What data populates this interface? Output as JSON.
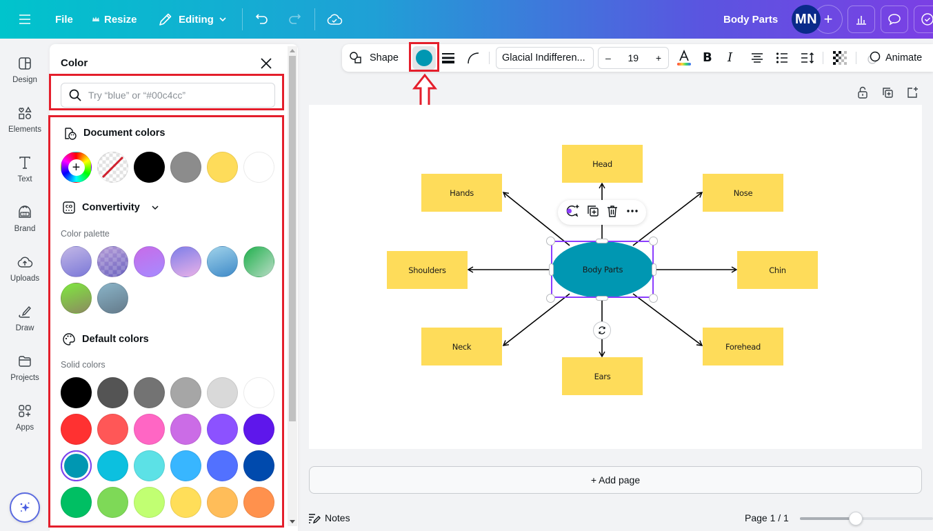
{
  "topbar": {
    "file_label": "File",
    "resize_label": "Resize",
    "editing_label": "Editing",
    "document_title": "Body Parts",
    "avatar_initials": "MN",
    "icons": [
      "menu-icon",
      "crown-icon",
      "pencil-icon",
      "chevron-down-icon",
      "undo-icon",
      "redo-icon",
      "cloud-check-icon",
      "plus-icon",
      "chart-icon",
      "comment-icon",
      "check-circle-icon"
    ]
  },
  "rail": {
    "items": [
      {
        "label": "Design",
        "icon": "design-icon"
      },
      {
        "label": "Elements",
        "icon": "elements-icon"
      },
      {
        "label": "Text",
        "icon": "text-icon"
      },
      {
        "label": "Brand",
        "icon": "brand-icon"
      },
      {
        "label": "Uploads",
        "icon": "uploads-icon"
      },
      {
        "label": "Draw",
        "icon": "draw-icon"
      },
      {
        "label": "Projects",
        "icon": "folder-icon"
      },
      {
        "label": "Apps",
        "icon": "apps-icon"
      }
    ],
    "magic_icon": "sparkle-icon"
  },
  "color_panel": {
    "title": "Color",
    "search_placeholder": "Try “blue” or “#00c4cc”",
    "search_value": "",
    "document_colors": {
      "heading": "Document colors",
      "swatches": [
        {
          "name": "add-color",
          "color": "rainbow"
        },
        {
          "name": "transparent",
          "color": "none"
        },
        {
          "name": "black",
          "color": "#000000"
        },
        {
          "name": "gray",
          "color": "#8c8c8c"
        },
        {
          "name": "yellow",
          "color": "#fedc5a"
        },
        {
          "name": "white",
          "color": "#ffffff"
        }
      ]
    },
    "brand_kit": {
      "heading": "Convertivity",
      "palette_label": "Color palette",
      "swatches": [
        {
          "from": "#c2b7e6",
          "to": "#7b78d8"
        },
        {
          "from": "#b39ad6",
          "to": "#6b63c0"
        },
        {
          "from": "#c86be8",
          "to": "#a68bff"
        },
        {
          "from": "#7e7ee8",
          "to": "#e9b1e8"
        },
        {
          "from": "#9fd2ea",
          "to": "#3f8ac8"
        },
        {
          "from": "#21b04d",
          "to": "#b8dcc5"
        },
        {
          "from": "#7fe83f",
          "to": "#8c8a60"
        },
        {
          "from": "#8ab4c8",
          "to": "#647a8a"
        }
      ]
    },
    "default_colors": {
      "heading": "Default colors",
      "solid_label": "Solid colors",
      "selected": "#0097b2",
      "rows": [
        [
          "#000000",
          "#545454",
          "#737373",
          "#a6a6a6",
          "#d9d9d9",
          "#ffffff"
        ],
        [
          "#ff3131",
          "#ff5757",
          "#ff66c4",
          "#cb6ce6",
          "#8c52ff",
          "#5e17eb"
        ],
        [
          "#0097b2",
          "#0cc0df",
          "#5ce1e6",
          "#38b6ff",
          "#5271ff",
          "#004aad"
        ],
        [
          "#00bf63",
          "#7ed957",
          "#c1ff72",
          "#ffde59",
          "#ffbd59",
          "#ff914d"
        ]
      ]
    }
  },
  "context_toolbar": {
    "shape_label": "Shape",
    "fill_color": "#0097b2",
    "font_name": "Glacial Indifferen...",
    "font_size": "19",
    "minus": "–",
    "plus": "+",
    "animate_label": "Animate",
    "icons": [
      "shape-icon",
      "border-style-icon",
      "corner-rounding-icon",
      "text-color-icon",
      "bold-icon",
      "italic-icon",
      "align-center-icon",
      "list-icon",
      "spacing-icon",
      "transparency-icon",
      "animate-icon"
    ]
  },
  "page_actions": [
    "unlock-icon",
    "duplicate-page-icon",
    "add-page-icon"
  ],
  "diagram": {
    "center": "Body Parts",
    "center_color": "#0097b2",
    "node_color": "#fedc5a",
    "nodes": [
      "Head",
      "Hands",
      "Nose",
      "Shoulders",
      "Chin",
      "Neck",
      "Forehead",
      "Ears"
    ]
  },
  "footer": {
    "add_page_label": "+ Add page",
    "notes_label": "Notes",
    "page_indicator": "Page 1 / 1",
    "zoom_fraction": 0.42
  },
  "annotations": {
    "highlight_color": "#e41e2b"
  }
}
